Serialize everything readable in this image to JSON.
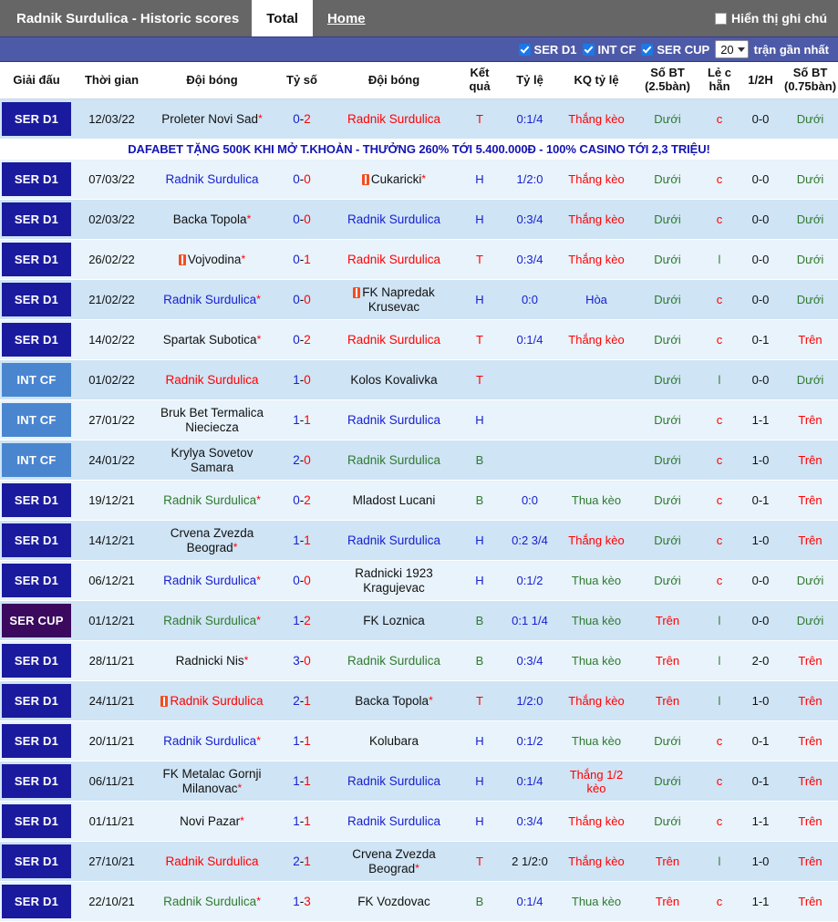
{
  "titlebar": {
    "title": "Radnik Surdulica - Historic scores",
    "tab_total": "Total",
    "tab_home": "Home",
    "show_notes_label": "Hiển thị ghi chú",
    "show_notes_icon": "checkbox-unchecked-icon"
  },
  "filterbar": {
    "filters": [
      {
        "label": "SER D1",
        "checked": true
      },
      {
        "label": "INT CF",
        "checked": true
      },
      {
        "label": "SER CUP",
        "checked": true
      }
    ],
    "count_value": "20",
    "count_suffix": "trận gần nhất",
    "caret_icon": "chevron-down-icon"
  },
  "banner": {
    "text": "DAFABET TẶNG 500K KHI MỞ T.KHOẢN - THƯỞNG 260% TỚI 5.400.000Đ - 100% CASINO TỚI 2,3 TRIỆU!"
  },
  "table": {
    "columns": [
      "Giải đấu",
      "Thời gian",
      "Đội bóng",
      "Tỷ số",
      "Đội bóng",
      "Kết quả",
      "Tỷ lệ",
      "KQ tỷ lệ",
      "Số BT (2.5bàn)",
      "Lẻ c hẵn",
      "1/2H",
      "Số BT (0.75bàn)"
    ],
    "rows": [
      {
        "league": "SER D1",
        "league_style": "lg-serd1",
        "time": "12/03/22",
        "home": "Proleter Novi Sad",
        "home_star": true,
        "home_card": false,
        "home_color": "c-black",
        "score": "0-2",
        "score_h": "0",
        "score_a": "2",
        "away": "Radnik Surdulica",
        "away_star": false,
        "away_card": false,
        "away_color": "c-red",
        "result": "T",
        "result_color": "c-red",
        "odds": "0:1/4",
        "odds_color": "c-blue",
        "odds_result": "Thắng kèo",
        "odds_result_color": "c-red",
        "ou25": "Dưới",
        "ou25_color": "c-green",
        "oddeven": "c",
        "oddeven_color": "c-red",
        "half": "0-0",
        "half_color": "c-black",
        "ou075": "Dưới",
        "ou075_color": "c-green"
      },
      {
        "league": "SER D1",
        "league_style": "lg-serd1",
        "time": "07/03/22",
        "home": "Radnik Surdulica",
        "home_star": false,
        "home_card": false,
        "home_color": "c-blue",
        "score": "0-0",
        "score_h": "0",
        "score_a": "0",
        "away": "Cukaricki",
        "away_star": true,
        "away_card": true,
        "away_color": "c-black",
        "result": "H",
        "result_color": "c-blue",
        "odds": "1/2:0",
        "odds_color": "c-blue",
        "odds_result": "Thắng kèo",
        "odds_result_color": "c-red",
        "ou25": "Dưới",
        "ou25_color": "c-green",
        "oddeven": "c",
        "oddeven_color": "c-red",
        "half": "0-0",
        "half_color": "c-black",
        "ou075": "Dưới",
        "ou075_color": "c-green"
      },
      {
        "league": "SER D1",
        "league_style": "lg-serd1",
        "time": "02/03/22",
        "home": "Backa Topola",
        "home_star": true,
        "home_card": false,
        "home_color": "c-black",
        "score": "0-0",
        "score_h": "0",
        "score_a": "0",
        "away": "Radnik Surdulica",
        "away_star": false,
        "away_card": false,
        "away_color": "c-blue",
        "result": "H",
        "result_color": "c-blue",
        "odds": "0:3/4",
        "odds_color": "c-blue",
        "odds_result": "Thắng kèo",
        "odds_result_color": "c-red",
        "ou25": "Dưới",
        "ou25_color": "c-green",
        "oddeven": "c",
        "oddeven_color": "c-red",
        "half": "0-0",
        "half_color": "c-black",
        "ou075": "Dưới",
        "ou075_color": "c-green"
      },
      {
        "league": "SER D1",
        "league_style": "lg-serd1",
        "time": "26/02/22",
        "home": "Vojvodina",
        "home_star": true,
        "home_card": true,
        "home_color": "c-black",
        "score": "0-1",
        "score_h": "0",
        "score_a": "1",
        "away": "Radnik Surdulica",
        "away_star": false,
        "away_card": false,
        "away_color": "c-red",
        "result": "T",
        "result_color": "c-red",
        "odds": "0:3/4",
        "odds_color": "c-blue",
        "odds_result": "Thắng kèo",
        "odds_result_color": "c-red",
        "ou25": "Dưới",
        "ou25_color": "c-green",
        "oddeven": "l",
        "oddeven_color": "c-green",
        "half": "0-0",
        "half_color": "c-black",
        "ou075": "Dưới",
        "ou075_color": "c-green"
      },
      {
        "league": "SER D1",
        "league_style": "lg-serd1",
        "time": "21/02/22",
        "home": "Radnik Surdulica",
        "home_star": true,
        "home_card": false,
        "home_color": "c-blue",
        "score": "0-0",
        "score_h": "0",
        "score_a": "0",
        "away": "FK Napredak Krusevac",
        "away_star": false,
        "away_card": true,
        "away_color": "c-black",
        "result": "H",
        "result_color": "c-blue",
        "odds": "0:0",
        "odds_color": "c-blue",
        "odds_result": "Hòa",
        "odds_result_color": "c-blue",
        "ou25": "Dưới",
        "ou25_color": "c-green",
        "oddeven": "c",
        "oddeven_color": "c-red",
        "half": "0-0",
        "half_color": "c-black",
        "ou075": "Dưới",
        "ou075_color": "c-green"
      },
      {
        "league": "SER D1",
        "league_style": "lg-serd1",
        "time": "14/02/22",
        "home": "Spartak Subotica",
        "home_star": true,
        "home_card": false,
        "home_color": "c-black",
        "score": "0-2",
        "score_h": "0",
        "score_a": "2",
        "away": "Radnik Surdulica",
        "away_star": false,
        "away_card": false,
        "away_color": "c-red",
        "result": "T",
        "result_color": "c-red",
        "odds": "0:1/4",
        "odds_color": "c-blue",
        "odds_result": "Thắng kèo",
        "odds_result_color": "c-red",
        "ou25": "Dưới",
        "ou25_color": "c-green",
        "oddeven": "c",
        "oddeven_color": "c-red",
        "half": "0-1",
        "half_color": "c-black",
        "ou075": "Trên",
        "ou075_color": "c-red"
      },
      {
        "league": "INT CF",
        "league_style": "lg-intcf",
        "time": "01/02/22",
        "home": "Radnik Surdulica",
        "home_star": false,
        "home_card": false,
        "home_color": "c-red",
        "score": "1-0",
        "score_h": "1",
        "score_a": "0",
        "away": "Kolos Kovalivka",
        "away_star": false,
        "away_card": false,
        "away_color": "c-black",
        "result": "T",
        "result_color": "c-red",
        "odds": "",
        "odds_color": "c-blue",
        "odds_result": "",
        "odds_result_color": "c-red",
        "ou25": "Dưới",
        "ou25_color": "c-green",
        "oddeven": "l",
        "oddeven_color": "c-green",
        "half": "0-0",
        "half_color": "c-black",
        "ou075": "Dưới",
        "ou075_color": "c-green"
      },
      {
        "league": "INT CF",
        "league_style": "lg-intcf",
        "time": "27/01/22",
        "home": "Bruk Bet Termalica Nieciecza",
        "home_star": false,
        "home_card": false,
        "home_color": "c-black",
        "score": "1-1",
        "score_h": "1",
        "score_a": "1",
        "away": "Radnik Surdulica",
        "away_star": false,
        "away_card": false,
        "away_color": "c-blue",
        "result": "H",
        "result_color": "c-blue",
        "odds": "",
        "odds_color": "c-blue",
        "odds_result": "",
        "odds_result_color": "c-red",
        "ou25": "Dưới",
        "ou25_color": "c-green",
        "oddeven": "c",
        "oddeven_color": "c-red",
        "half": "1-1",
        "half_color": "c-black",
        "ou075": "Trên",
        "ou075_color": "c-red"
      },
      {
        "league": "INT CF",
        "league_style": "lg-intcf",
        "time": "24/01/22",
        "home": "Krylya Sovetov Samara",
        "home_star": false,
        "home_card": false,
        "home_color": "c-black",
        "score": "2-0",
        "score_h": "2",
        "score_a": "0",
        "away": "Radnik Surdulica",
        "away_star": false,
        "away_card": false,
        "away_color": "c-green",
        "result": "B",
        "result_color": "c-green",
        "odds": "",
        "odds_color": "c-blue",
        "odds_result": "",
        "odds_result_color": "c-red",
        "ou25": "Dưới",
        "ou25_color": "c-green",
        "oddeven": "c",
        "oddeven_color": "c-red",
        "half": "1-0",
        "half_color": "c-black",
        "ou075": "Trên",
        "ou075_color": "c-red"
      },
      {
        "league": "SER D1",
        "league_style": "lg-serd1",
        "time": "19/12/21",
        "home": "Radnik Surdulica",
        "home_star": true,
        "home_card": false,
        "home_color": "c-green",
        "score": "0-2",
        "score_h": "0",
        "score_a": "2",
        "away": "Mladost Lucani",
        "away_star": false,
        "away_card": false,
        "away_color": "c-black",
        "result": "B",
        "result_color": "c-green",
        "odds": "0:0",
        "odds_color": "c-blue",
        "odds_result": "Thua kèo",
        "odds_result_color": "c-green",
        "ou25": "Dưới",
        "ou25_color": "c-green",
        "oddeven": "c",
        "oddeven_color": "c-red",
        "half": "0-1",
        "half_color": "c-black",
        "ou075": "Trên",
        "ou075_color": "c-red"
      },
      {
        "league": "SER D1",
        "league_style": "lg-serd1",
        "time": "14/12/21",
        "home": "Crvena Zvezda Beograd",
        "home_star": true,
        "home_card": false,
        "home_color": "c-black",
        "score": "1-1",
        "score_h": "1",
        "score_a": "1",
        "away": "Radnik Surdulica",
        "away_star": false,
        "away_card": false,
        "away_color": "c-blue",
        "result": "H",
        "result_color": "c-blue",
        "odds": "0:2 3/4",
        "odds_color": "c-blue",
        "odds_result": "Thắng kèo",
        "odds_result_color": "c-red",
        "ou25": "Dưới",
        "ou25_color": "c-green",
        "oddeven": "c",
        "oddeven_color": "c-red",
        "half": "1-0",
        "half_color": "c-black",
        "ou075": "Trên",
        "ou075_color": "c-red"
      },
      {
        "league": "SER D1",
        "league_style": "lg-serd1",
        "time": "06/12/21",
        "home": "Radnik Surdulica",
        "home_star": true,
        "home_card": false,
        "home_color": "c-blue",
        "score": "0-0",
        "score_h": "0",
        "score_a": "0",
        "away": "Radnicki 1923 Kragujevac",
        "away_star": false,
        "away_card": false,
        "away_color": "c-black",
        "result": "H",
        "result_color": "c-blue",
        "odds": "0:1/2",
        "odds_color": "c-blue",
        "odds_result": "Thua kèo",
        "odds_result_color": "c-green",
        "ou25": "Dưới",
        "ou25_color": "c-green",
        "oddeven": "c",
        "oddeven_color": "c-red",
        "half": "0-0",
        "half_color": "c-black",
        "ou075": "Dưới",
        "ou075_color": "c-green"
      },
      {
        "league": "SER CUP",
        "league_style": "lg-sercup",
        "time": "01/12/21",
        "home": "Radnik Surdulica",
        "home_star": true,
        "home_card": false,
        "home_color": "c-green",
        "score": "1-2",
        "score_h": "1",
        "score_a": "2",
        "away": "FK Loznica",
        "away_star": false,
        "away_card": false,
        "away_color": "c-black",
        "result": "B",
        "result_color": "c-green",
        "odds": "0:1 1/4",
        "odds_color": "c-blue",
        "odds_result": "Thua kèo",
        "odds_result_color": "c-green",
        "ou25": "Trên",
        "ou25_color": "c-red",
        "oddeven": "l",
        "oddeven_color": "c-green",
        "half": "0-0",
        "half_color": "c-black",
        "ou075": "Dưới",
        "ou075_color": "c-green"
      },
      {
        "league": "SER D1",
        "league_style": "lg-serd1",
        "time": "28/11/21",
        "home": "Radnicki Nis",
        "home_star": true,
        "home_card": false,
        "home_color": "c-black",
        "score": "3-0",
        "score_h": "3",
        "score_a": "0",
        "away": "Radnik Surdulica",
        "away_star": false,
        "away_card": false,
        "away_color": "c-green",
        "result": "B",
        "result_color": "c-green",
        "odds": "0:3/4",
        "odds_color": "c-blue",
        "odds_result": "Thua kèo",
        "odds_result_color": "c-green",
        "ou25": "Trên",
        "ou25_color": "c-red",
        "oddeven": "l",
        "oddeven_color": "c-green",
        "half": "2-0",
        "half_color": "c-black",
        "ou075": "Trên",
        "ou075_color": "c-red"
      },
      {
        "league": "SER D1",
        "league_style": "lg-serd1",
        "time": "24/11/21",
        "home": "Radnik Surdulica",
        "home_star": false,
        "home_card": true,
        "home_color": "c-red",
        "score": "2-1",
        "score_h": "2",
        "score_a": "1",
        "away": "Backa Topola",
        "away_star": true,
        "away_card": false,
        "away_color": "c-black",
        "result": "T",
        "result_color": "c-red",
        "odds": "1/2:0",
        "odds_color": "c-blue",
        "odds_result": "Thắng kèo",
        "odds_result_color": "c-red",
        "ou25": "Trên",
        "ou25_color": "c-red",
        "oddeven": "l",
        "oddeven_color": "c-green",
        "half": "1-0",
        "half_color": "c-black",
        "ou075": "Trên",
        "ou075_color": "c-red"
      },
      {
        "league": "SER D1",
        "league_style": "lg-serd1",
        "time": "20/11/21",
        "home": "Radnik Surdulica",
        "home_star": true,
        "home_card": false,
        "home_color": "c-blue",
        "score": "1-1",
        "score_h": "1",
        "score_a": "1",
        "away": "Kolubara",
        "away_star": false,
        "away_card": false,
        "away_color": "c-black",
        "result": "H",
        "result_color": "c-blue",
        "odds": "0:1/2",
        "odds_color": "c-blue",
        "odds_result": "Thua kèo",
        "odds_result_color": "c-green",
        "ou25": "Dưới",
        "ou25_color": "c-green",
        "oddeven": "c",
        "oddeven_color": "c-red",
        "half": "0-1",
        "half_color": "c-black",
        "ou075": "Trên",
        "ou075_color": "c-red"
      },
      {
        "league": "SER D1",
        "league_style": "lg-serd1",
        "time": "06/11/21",
        "home": "FK Metalac Gornji Milanovac",
        "home_star": true,
        "home_card": false,
        "home_color": "c-black",
        "score": "1-1",
        "score_h": "1",
        "score_a": "1",
        "away": "Radnik Surdulica",
        "away_star": false,
        "away_card": false,
        "away_color": "c-blue",
        "result": "H",
        "result_color": "c-blue",
        "odds": "0:1/4",
        "odds_color": "c-blue",
        "odds_result": "Thắng 1/2 kèo",
        "odds_result_color": "c-red",
        "ou25": "Dưới",
        "ou25_color": "c-green",
        "oddeven": "c",
        "oddeven_color": "c-red",
        "half": "0-1",
        "half_color": "c-black",
        "ou075": "Trên",
        "ou075_color": "c-red"
      },
      {
        "league": "SER D1",
        "league_style": "lg-serd1",
        "time": "01/11/21",
        "home": "Novi Pazar",
        "home_star": true,
        "home_card": false,
        "home_color": "c-black",
        "score": "1-1",
        "score_h": "1",
        "score_a": "1",
        "away": "Radnik Surdulica",
        "away_star": false,
        "away_card": false,
        "away_color": "c-blue",
        "result": "H",
        "result_color": "c-blue",
        "odds": "0:3/4",
        "odds_color": "c-blue",
        "odds_result": "Thắng kèo",
        "odds_result_color": "c-red",
        "ou25": "Dưới",
        "ou25_color": "c-green",
        "oddeven": "c",
        "oddeven_color": "c-red",
        "half": "1-1",
        "half_color": "c-black",
        "ou075": "Trên",
        "ou075_color": "c-red"
      },
      {
        "league": "SER D1",
        "league_style": "lg-serd1",
        "time": "27/10/21",
        "home": "Radnik Surdulica",
        "home_star": false,
        "home_card": false,
        "home_color": "c-red",
        "score": "2-1",
        "score_h": "2",
        "score_a": "1",
        "away": "Crvena Zvezda Beograd",
        "away_star": true,
        "away_card": false,
        "away_color": "c-black",
        "result": "T",
        "result_color": "c-red",
        "odds": "2 1/2:0",
        "odds_color": "c-black",
        "odds_result": "Thắng kèo",
        "odds_result_color": "c-red",
        "ou25": "Trên",
        "ou25_color": "c-red",
        "oddeven": "l",
        "oddeven_color": "c-green",
        "half": "1-0",
        "half_color": "c-black",
        "ou075": "Trên",
        "ou075_color": "c-red"
      },
      {
        "league": "SER D1",
        "league_style": "lg-serd1",
        "time": "22/10/21",
        "home": "Radnik Surdulica",
        "home_star": true,
        "home_card": false,
        "home_color": "c-green",
        "score": "1-3",
        "score_h": "1",
        "score_a": "3",
        "away": "FK Vozdovac",
        "away_star": false,
        "away_card": false,
        "away_color": "c-black",
        "result": "B",
        "result_color": "c-green",
        "odds": "0:1/4",
        "odds_color": "c-blue",
        "odds_result": "Thua kèo",
        "odds_result_color": "c-green",
        "ou25": "Trên",
        "ou25_color": "c-red",
        "oddeven": "c",
        "oddeven_color": "c-red",
        "half": "1-1",
        "half_color": "c-black",
        "ou075": "Trên",
        "ou075_color": "c-red"
      }
    ]
  },
  "colors": {
    "titlebar_bg": "#666666",
    "filterbar_bg": "#4d5aa8",
    "league_serd1": "#1a1a9e",
    "league_intcf": "#4a86d0",
    "league_sercup": "#3b0a5e",
    "row_odd": "#cfe4f5",
    "row_even": "#e8f3fb",
    "banner_text": "#1414b4",
    "win": "#ff0000",
    "draw": "#1820d0",
    "loss": "#2f7a2f"
  }
}
